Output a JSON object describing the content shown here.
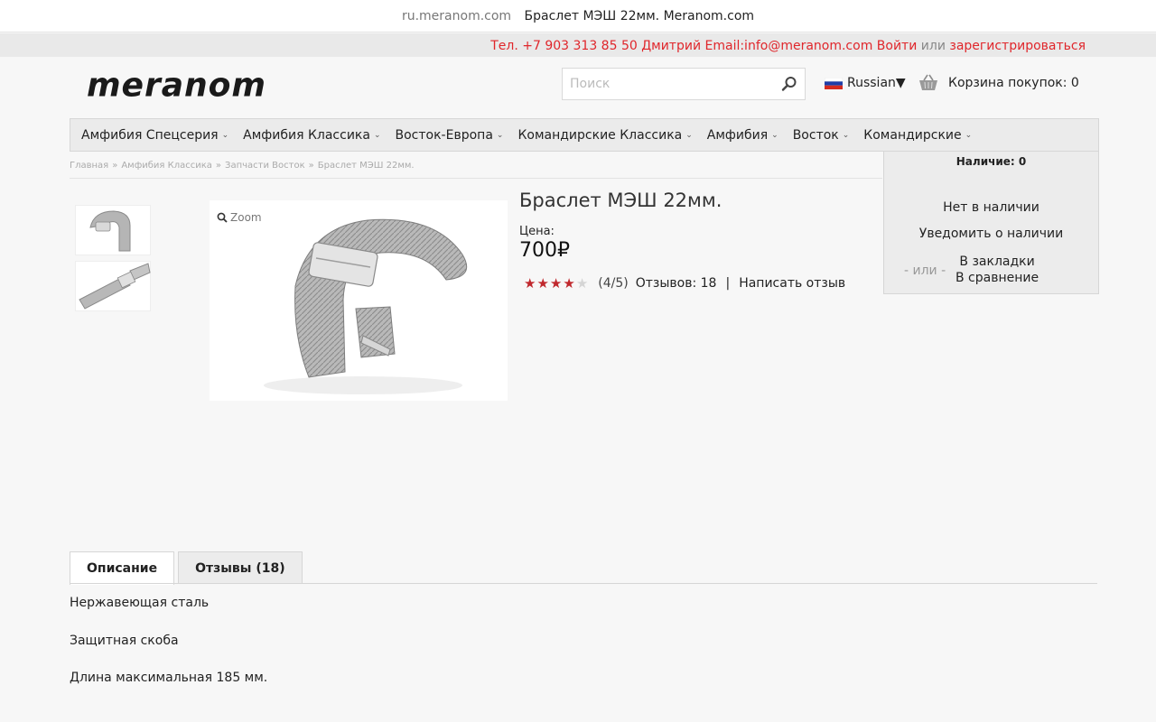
{
  "window": {
    "domain": "ru.meranom.com",
    "title": "Браслет МЭШ 22мм. Meranom.com"
  },
  "topbar": {
    "phone": "Тел. +7 903 313 85 50 Дмитрий",
    "email": "Email:info@meranom.com",
    "login": "Войти",
    "or": "или",
    "register": "зарегистрироваться"
  },
  "header": {
    "logo_text": "meranom",
    "search_placeholder": "Поиск",
    "language": "Russian▼",
    "cart": "Корзина покупок: 0"
  },
  "nav": {
    "items": [
      "Амфибия Спецсерия",
      "Амфибия Классика",
      "Восток-Европа",
      "Командирские Классика",
      "Амфибия",
      "Восток",
      "Командирские"
    ]
  },
  "dropdown": {
    "stock_count": "Наличие: 0",
    "not_available": "Нет в наличии",
    "notify": "Уведомить о наличии",
    "or": "- или -",
    "bookmark": "В закладки",
    "compare": "В сравнение"
  },
  "breadcrumb": [
    "Главная",
    "Амфибия Классика",
    "Запчасти Восток",
    "Браслет МЭШ 22мм."
  ],
  "product": {
    "zoom": "Zoom",
    "title": "Браслет МЭШ 22мм.",
    "price_label": "Цена:",
    "price": "700₽",
    "rating": 4,
    "rating_max": 5,
    "rating_text": "(4/5)",
    "reviews": "Отзывов: 18",
    "separator": "|",
    "write_review": "Написать отзыв"
  },
  "tabs": [
    "Описание",
    "Отзывы (18)"
  ],
  "description": [
    "Нержавеющая сталь",
    "Защитная скоба",
    "Длина максимальная 185 мм."
  ],
  "colors": {
    "accent_red": "#e0262b",
    "star": "#c0282d"
  }
}
